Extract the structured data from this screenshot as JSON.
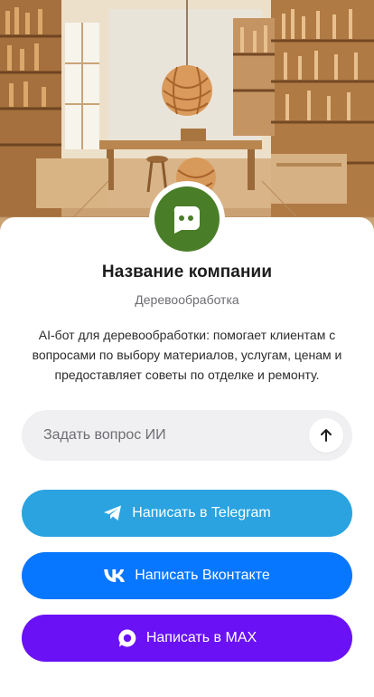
{
  "colors": {
    "avatar_bg": "#4a7d28",
    "telegram": "#2aa3e0",
    "vkontakte": "#0877ff",
    "max": "#6a11f5"
  },
  "hero": {
    "icon": "woodworking-workshop-illustration"
  },
  "profile": {
    "avatar_icon": "chat-bot-icon",
    "company_name": "Название компании",
    "category": "Деревообработка",
    "description": "AI-бот для деревообработки: помогает клиентам с вопросами по выбору материалов, услугам, ценам и предоставляет советы по отделке и ремонту."
  },
  "ask": {
    "placeholder": "Задать вопрос ИИ",
    "value": "",
    "send_icon": "arrow-up-icon"
  },
  "actions": [
    {
      "label": "Написать в Telegram",
      "icon": "telegram-icon"
    },
    {
      "label": "Написать Вконтакте",
      "icon": "vk-icon"
    },
    {
      "label": "Написать в MAX",
      "icon": "max-icon"
    }
  ]
}
